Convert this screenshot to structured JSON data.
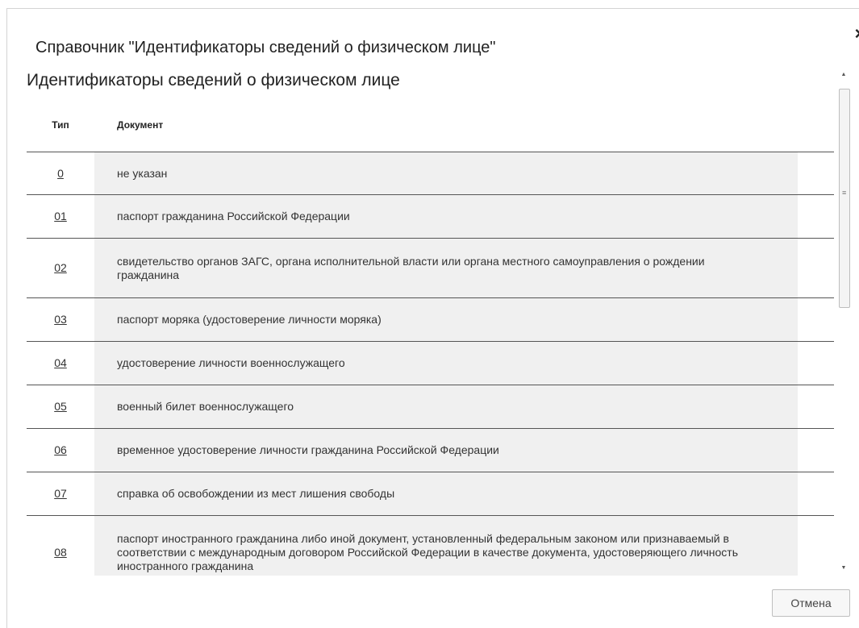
{
  "dialog": {
    "title": "Справочник \"Идентификаторы сведений о физическом лице\"",
    "close_icon": "×",
    "section_title": "Идентификаторы сведений о физическом лице",
    "columns": {
      "type": "Тип",
      "document": "Документ"
    },
    "rows": [
      {
        "type": "0",
        "document": "не указан"
      },
      {
        "type": "01",
        "document": "паспорт гражданина Российской Федерации"
      },
      {
        "type": "02",
        "document": "свидетельство органов ЗАГС, органа исполнительной власти или органа местного самоуправления о рождении гражданина"
      },
      {
        "type": "03",
        "document": "паспорт моряка (удостоверение личности моряка)"
      },
      {
        "type": "04",
        "document": "удостоверение личности военнослужащего"
      },
      {
        "type": "05",
        "document": "военный билет военнослужащего"
      },
      {
        "type": "06",
        "document": "временное удостоверение личности гражданина Российской Федерации"
      },
      {
        "type": "07",
        "document": "справка об освобождении из мест лишения свободы"
      },
      {
        "type": "08",
        "document": "паспорт иностранного гражданина либо иной документ, установленный федеральным законом или признаваемый в соответствии с международным договором Российской Федерации в качестве документа, удостоверяющего личность иностранного гражданина"
      }
    ],
    "cancel_label": "Отмена"
  },
  "scrollbar": {
    "up_icon": "▲",
    "down_icon": "▼",
    "grip_icon": "≡"
  }
}
